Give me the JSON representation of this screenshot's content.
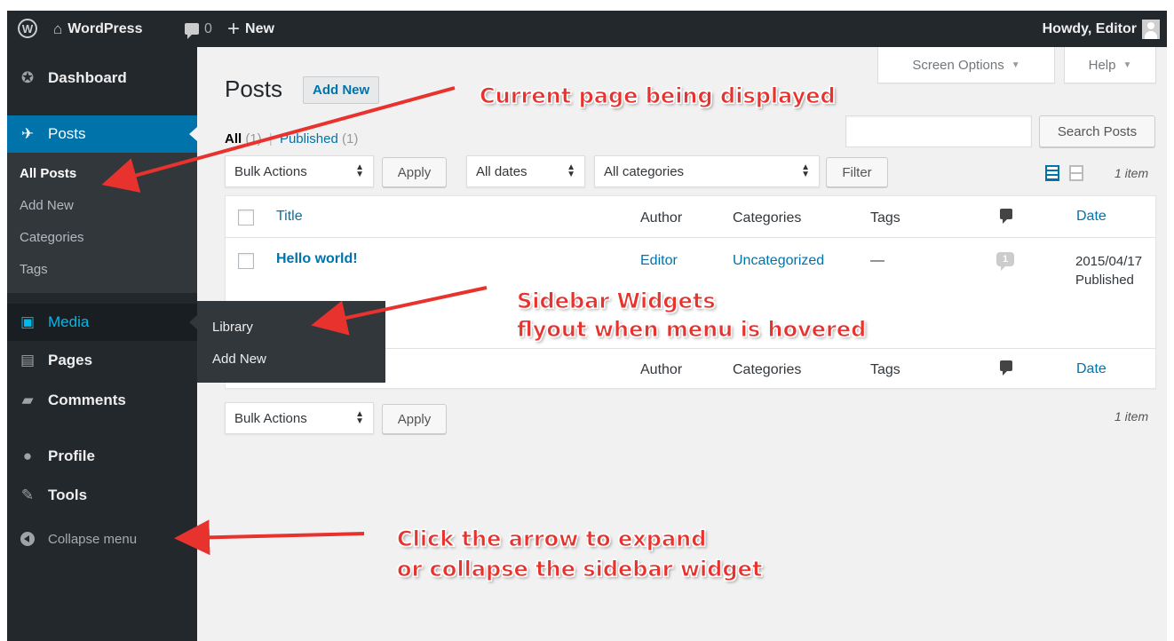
{
  "adminbar": {
    "site_name": "WordPress",
    "comments_count": "0",
    "new_label": "New",
    "howdy": "Howdy, Editor"
  },
  "sidebar": {
    "dashboard": "Dashboard",
    "posts": "Posts",
    "submenu": [
      "All Posts",
      "Add New",
      "Categories",
      "Tags"
    ],
    "media": "Media",
    "pages": "Pages",
    "comments": "Comments",
    "profile": "Profile",
    "tools": "Tools",
    "collapse": "Collapse menu"
  },
  "flyout": [
    "Library",
    "Add New"
  ],
  "screen": {
    "screen_options": "Screen Options",
    "help": "Help",
    "title": "Posts",
    "add_new": "Add New",
    "filters": {
      "all": "All",
      "all_count": "(1)",
      "separator": "|",
      "published": "Published",
      "published_count": "(1)"
    },
    "search_placeholder": "",
    "search_button": "Search Posts",
    "bulk_actions": "Bulk Actions",
    "apply": "Apply",
    "all_dates": "All dates",
    "all_categories": "All categories",
    "filter": "Filter",
    "item_count": "1 item"
  },
  "table": {
    "columns": [
      "Title",
      "Author",
      "Categories",
      "Tags",
      "Date"
    ],
    "row": {
      "title": "Hello world!",
      "author": "Editor",
      "categories": "Uncategorized",
      "tags": "—",
      "comments": "1",
      "date": "2015/04/17",
      "status": "Published"
    }
  },
  "annotations": {
    "current_page": "Current page being displayed",
    "flyout_line1": "Sidebar Widgets",
    "flyout_line2": "flyout when menu is hovered",
    "collapse_line1": "Click the arrow to expand",
    "collapse_line2": "or collapse the sidebar widget"
  },
  "colors": {
    "admin_dark": "#23282d",
    "submenu_bg": "#32373c",
    "accent_blue": "#0073aa",
    "hover_blue": "#00b9eb",
    "content_bg": "#f1f1f1",
    "annotation_red": "#e8322e"
  },
  "icons": {
    "wp_logo": "wordpress-logo-icon",
    "home": "home-icon",
    "comments": "comment-bubble-icon",
    "new": "plus-icon"
  }
}
